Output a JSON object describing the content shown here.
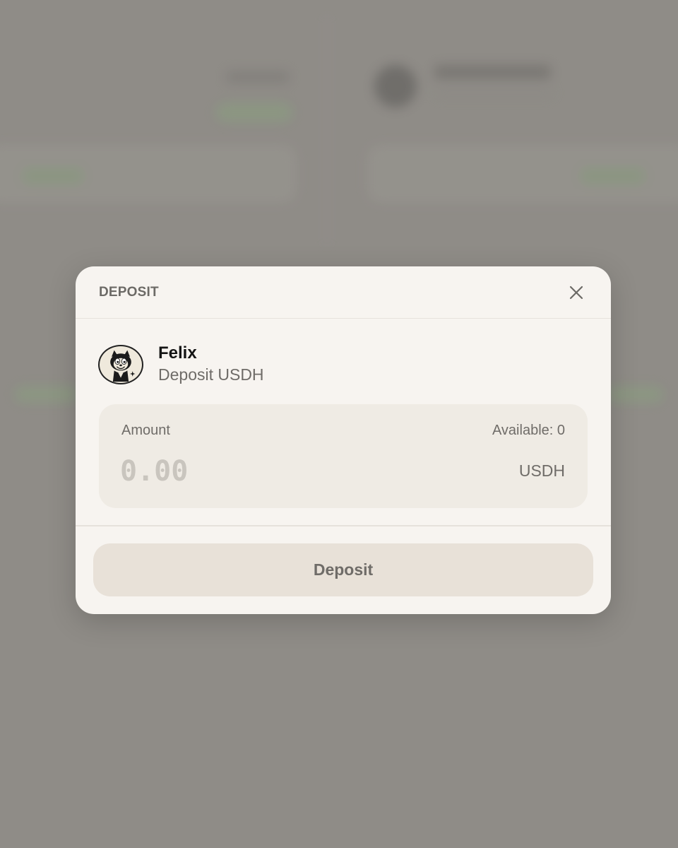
{
  "modal": {
    "title": "DEPOSIT",
    "protocol": {
      "name": "Felix",
      "subtitle": "Deposit USDH",
      "avatar_icon": "felix-cat-logo"
    },
    "amount": {
      "label": "Amount",
      "available": "Available: 0",
      "placeholder": "0.00",
      "value": "",
      "currency": "USDH"
    },
    "submit_label": "Deposit",
    "close_icon": "close-icon"
  },
  "colors": {
    "modal_bg": "#f7f4f0",
    "amount_box_bg": "#efebe4",
    "button_bg": "#e8e1d8",
    "backdrop": "#8f8c87",
    "accent_green": "#8a9d80"
  }
}
